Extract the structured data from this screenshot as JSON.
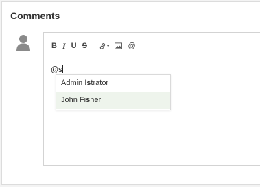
{
  "comments": {
    "title": "Comments"
  },
  "toolbar": {
    "bold": "B",
    "italic": "I",
    "underline": "U",
    "strikethrough": "S",
    "link_dropdown_caret": "▾",
    "mention": "@",
    "icons": [
      "bold-icon",
      "italic-icon",
      "underline-icon",
      "strikethrough-icon",
      "link-icon",
      "image-icon",
      "mention-icon"
    ]
  },
  "editor": {
    "value": "@s"
  },
  "mention_suggestions": [
    {
      "before": "Admin I",
      "match": "s",
      "after": "trator",
      "highlighted": false
    },
    {
      "before": "John Fi",
      "match": "s",
      "after": "her",
      "highlighted": true
    }
  ],
  "colors": {
    "highlight_row": "#eef4ec",
    "avatar": "#8a8a8a"
  }
}
